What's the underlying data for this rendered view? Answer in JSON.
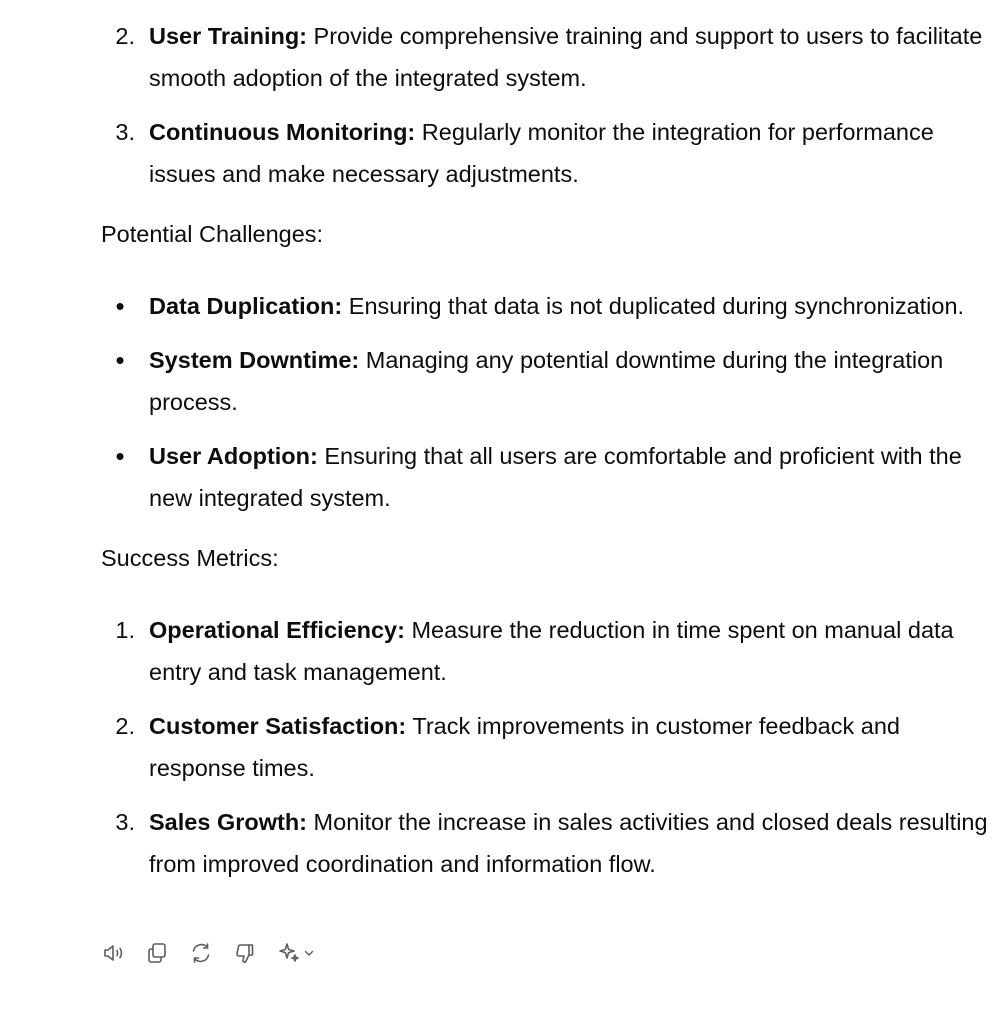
{
  "message": {
    "list1": {
      "items": [
        {
          "marker": "2.",
          "title": "User Training:",
          "text": " Provide comprehensive training and support to users to facilitate smooth adoption of the integrated system."
        },
        {
          "marker": "3.",
          "title": "Continuous Monitoring:",
          "text": " Regularly monitor the integration for performance issues and make necessary adjustments."
        }
      ]
    },
    "challenges": {
      "heading": "Potential Challenges:",
      "items": [
        {
          "marker": "•",
          "title": "Data Duplication:",
          "text": " Ensuring that data is not duplicated during synchronization."
        },
        {
          "marker": "•",
          "title": "System Downtime:",
          "text": " Managing any potential downtime during the integration process."
        },
        {
          "marker": "•",
          "title": "User Adoption:",
          "text": " Ensuring that all users are comfortable and proficient with the new integrated system."
        }
      ]
    },
    "metrics": {
      "heading": "Success Metrics:",
      "items": [
        {
          "marker": "1.",
          "title": "Operational Efficiency:",
          "text": " Measure the reduction in time spent on manual data entry and task management."
        },
        {
          "marker": "2.",
          "title": "Customer Satisfaction:",
          "text": " Track improvements in customer feedback and response times."
        },
        {
          "marker": "3.",
          "title": "Sales Growth:",
          "text": " Monitor the increase in sales activities and closed deals resulting from improved coordination and information flow."
        }
      ]
    }
  },
  "toolbar": {
    "icons": [
      "read-aloud-icon",
      "copy-icon",
      "regenerate-icon",
      "thumbs-down-icon",
      "sparkle-icon",
      "chevron-down-icon"
    ]
  }
}
